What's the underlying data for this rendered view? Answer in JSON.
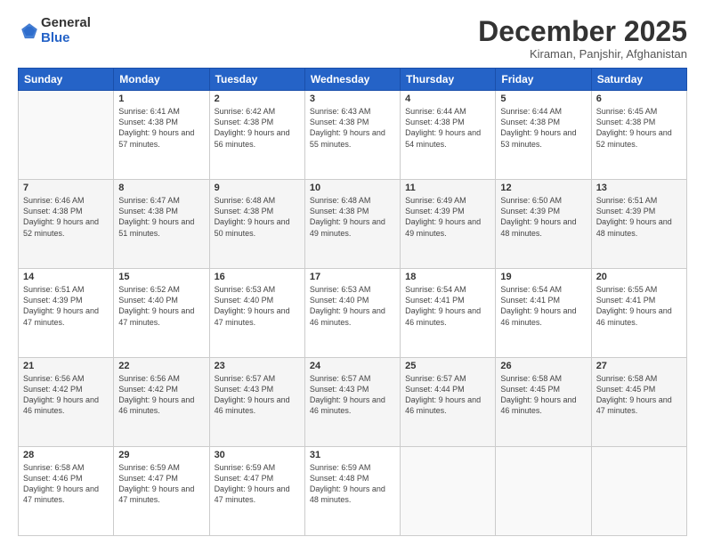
{
  "logo": {
    "general": "General",
    "blue": "Blue"
  },
  "header": {
    "month": "December 2025",
    "location": "Kiraman, Panjshir, Afghanistan"
  },
  "days_of_week": [
    "Sunday",
    "Monday",
    "Tuesday",
    "Wednesday",
    "Thursday",
    "Friday",
    "Saturday"
  ],
  "weeks": [
    [
      {
        "day": "",
        "info": ""
      },
      {
        "day": "1",
        "info": "Sunrise: 6:41 AM\nSunset: 4:38 PM\nDaylight: 9 hours\nand 57 minutes."
      },
      {
        "day": "2",
        "info": "Sunrise: 6:42 AM\nSunset: 4:38 PM\nDaylight: 9 hours\nand 56 minutes."
      },
      {
        "day": "3",
        "info": "Sunrise: 6:43 AM\nSunset: 4:38 PM\nDaylight: 9 hours\nand 55 minutes."
      },
      {
        "day": "4",
        "info": "Sunrise: 6:44 AM\nSunset: 4:38 PM\nDaylight: 9 hours\nand 54 minutes."
      },
      {
        "day": "5",
        "info": "Sunrise: 6:44 AM\nSunset: 4:38 PM\nDaylight: 9 hours\nand 53 minutes."
      },
      {
        "day": "6",
        "info": "Sunrise: 6:45 AM\nSunset: 4:38 PM\nDaylight: 9 hours\nand 52 minutes."
      }
    ],
    [
      {
        "day": "7",
        "info": "Sunrise: 6:46 AM\nSunset: 4:38 PM\nDaylight: 9 hours\nand 52 minutes."
      },
      {
        "day": "8",
        "info": "Sunrise: 6:47 AM\nSunset: 4:38 PM\nDaylight: 9 hours\nand 51 minutes."
      },
      {
        "day": "9",
        "info": "Sunrise: 6:48 AM\nSunset: 4:38 PM\nDaylight: 9 hours\nand 50 minutes."
      },
      {
        "day": "10",
        "info": "Sunrise: 6:48 AM\nSunset: 4:38 PM\nDaylight: 9 hours\nand 49 minutes."
      },
      {
        "day": "11",
        "info": "Sunrise: 6:49 AM\nSunset: 4:39 PM\nDaylight: 9 hours\nand 49 minutes."
      },
      {
        "day": "12",
        "info": "Sunrise: 6:50 AM\nSunset: 4:39 PM\nDaylight: 9 hours\nand 48 minutes."
      },
      {
        "day": "13",
        "info": "Sunrise: 6:51 AM\nSunset: 4:39 PM\nDaylight: 9 hours\nand 48 minutes."
      }
    ],
    [
      {
        "day": "14",
        "info": "Sunrise: 6:51 AM\nSunset: 4:39 PM\nDaylight: 9 hours\nand 47 minutes."
      },
      {
        "day": "15",
        "info": "Sunrise: 6:52 AM\nSunset: 4:40 PM\nDaylight: 9 hours\nand 47 minutes."
      },
      {
        "day": "16",
        "info": "Sunrise: 6:53 AM\nSunset: 4:40 PM\nDaylight: 9 hours\nand 47 minutes."
      },
      {
        "day": "17",
        "info": "Sunrise: 6:53 AM\nSunset: 4:40 PM\nDaylight: 9 hours\nand 46 minutes."
      },
      {
        "day": "18",
        "info": "Sunrise: 6:54 AM\nSunset: 4:41 PM\nDaylight: 9 hours\nand 46 minutes."
      },
      {
        "day": "19",
        "info": "Sunrise: 6:54 AM\nSunset: 4:41 PM\nDaylight: 9 hours\nand 46 minutes."
      },
      {
        "day": "20",
        "info": "Sunrise: 6:55 AM\nSunset: 4:41 PM\nDaylight: 9 hours\nand 46 minutes."
      }
    ],
    [
      {
        "day": "21",
        "info": "Sunrise: 6:56 AM\nSunset: 4:42 PM\nDaylight: 9 hours\nand 46 minutes."
      },
      {
        "day": "22",
        "info": "Sunrise: 6:56 AM\nSunset: 4:42 PM\nDaylight: 9 hours\nand 46 minutes."
      },
      {
        "day": "23",
        "info": "Sunrise: 6:57 AM\nSunset: 4:43 PM\nDaylight: 9 hours\nand 46 minutes."
      },
      {
        "day": "24",
        "info": "Sunrise: 6:57 AM\nSunset: 4:43 PM\nDaylight: 9 hours\nand 46 minutes."
      },
      {
        "day": "25",
        "info": "Sunrise: 6:57 AM\nSunset: 4:44 PM\nDaylight: 9 hours\nand 46 minutes."
      },
      {
        "day": "26",
        "info": "Sunrise: 6:58 AM\nSunset: 4:45 PM\nDaylight: 9 hours\nand 46 minutes."
      },
      {
        "day": "27",
        "info": "Sunrise: 6:58 AM\nSunset: 4:45 PM\nDaylight: 9 hours\nand 47 minutes."
      }
    ],
    [
      {
        "day": "28",
        "info": "Sunrise: 6:58 AM\nSunset: 4:46 PM\nDaylight: 9 hours\nand 47 minutes."
      },
      {
        "day": "29",
        "info": "Sunrise: 6:59 AM\nSunset: 4:47 PM\nDaylight: 9 hours\nand 47 minutes."
      },
      {
        "day": "30",
        "info": "Sunrise: 6:59 AM\nSunset: 4:47 PM\nDaylight: 9 hours\nand 47 minutes."
      },
      {
        "day": "31",
        "info": "Sunrise: 6:59 AM\nSunset: 4:48 PM\nDaylight: 9 hours\nand 48 minutes."
      },
      {
        "day": "",
        "info": ""
      },
      {
        "day": "",
        "info": ""
      },
      {
        "day": "",
        "info": ""
      }
    ]
  ]
}
